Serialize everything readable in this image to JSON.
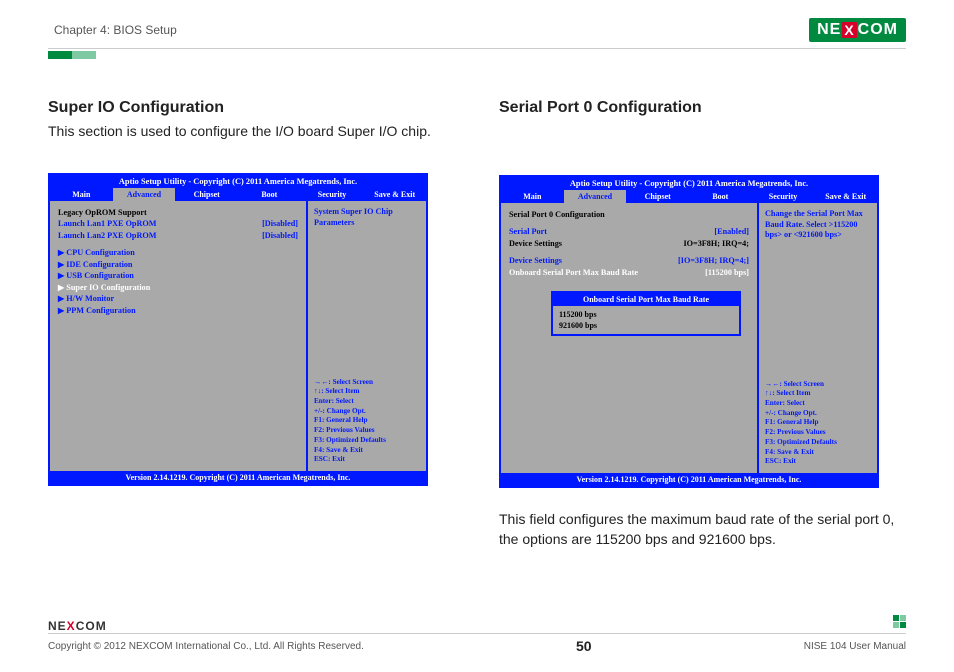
{
  "header": {
    "chapter": "Chapter 4: BIOS Setup",
    "brand_left": "NE",
    "brand_x": "X",
    "brand_right": "COM"
  },
  "left": {
    "title": "Super IO Configuration",
    "desc": "This section is used to configure the I/O board Super I/O chip.",
    "bios": {
      "top": "Aptio Setup Utility - Copyright (C) 2011 America Megatrends, Inc.",
      "tabs": [
        "Main",
        "Advanced",
        "Chipset",
        "Boot",
        "Security",
        "Save & Exit"
      ],
      "active_tab": 1,
      "group_label": "Legacy OpROM Support",
      "rows": [
        {
          "label": "Launch Lan1 PXE OpROM",
          "value": "[Disabled]"
        },
        {
          "label": "Launch Lan2 PXE OpROM",
          "value": "[Disabled]"
        }
      ],
      "subs": [
        {
          "label": "CPU Configuration",
          "hl": false
        },
        {
          "label": "IDE  Configuration",
          "hl": false
        },
        {
          "label": "USB Configuration",
          "hl": false
        },
        {
          "label": "Super IO Configuration",
          "hl": true
        },
        {
          "label": "H/W Monitor",
          "hl": false
        },
        {
          "label": "PPM Configuration",
          "hl": false
        }
      ],
      "help_title": "System Super IO Chip Parameters",
      "keys": [
        "→←: Select Screen",
        "↑↓: Select Item",
        "Enter: Select",
        "+/-: Change Opt.",
        "F1: General Help",
        "F2: Previous Values",
        "F3: Optimized Defaults",
        "F4: Save & Exit",
        "ESC: Exit"
      ],
      "footer": "Version 2.14.1219. Copyright (C) 2011 American Megatrends, Inc."
    }
  },
  "right": {
    "title": "Serial Port 0 Configuration",
    "bios": {
      "top": "Aptio Setup Utility - Copyright (C) 2011 America Megatrends, Inc.",
      "tabs": [
        "Main",
        "Advanced",
        "Chipset",
        "Boot",
        "Security",
        "Save & Exit"
      ],
      "active_tab": 1,
      "group_label": "Serial Port 0 Configuration",
      "rows1": [
        {
          "label": "Serial Port",
          "value": "[Enabled]",
          "blue": true
        },
        {
          "label": "Device Settings",
          "value": "IO=3F8H;  IRQ=4;",
          "blue": false
        }
      ],
      "rows2": [
        {
          "label": "Device Settings",
          "value": "[IO=3F8H;  IRQ=4;]",
          "blue": true
        },
        {
          "label": "Onboard Serial Port Max Baud Rate",
          "value": "[115200    bps]",
          "white": true
        }
      ],
      "popup": {
        "title": "Onboard Serial Port Max Baud Rate",
        "items": [
          "115200  bps",
          "921600  bps"
        ],
        "selected": 0
      },
      "help_title": "Change the Serial Port Max Baud Rate. Select >115200 bps> or <921600 bps>",
      "keys": [
        "→←: Select Screen",
        "↑↓: Select Item",
        "Enter: Select",
        "+/-: Change Opt.",
        "F1: General Help",
        "F2: Previous Values",
        "F3: Optimized Defaults",
        "F4: Save & Exit",
        "ESC: Exit"
      ],
      "footer": "Version 2.14.1219. Copyright (C) 2011 American Megatrends, Inc."
    },
    "foot_desc": "This field configures the maximum baud rate of the serial port 0, the options are 115200 bps and 921600 bps."
  },
  "footer": {
    "copyright": "Copyright © 2012 NEXCOM International Co., Ltd. All Rights Reserved.",
    "page": "50",
    "manual": "NISE 104 User Manual"
  }
}
